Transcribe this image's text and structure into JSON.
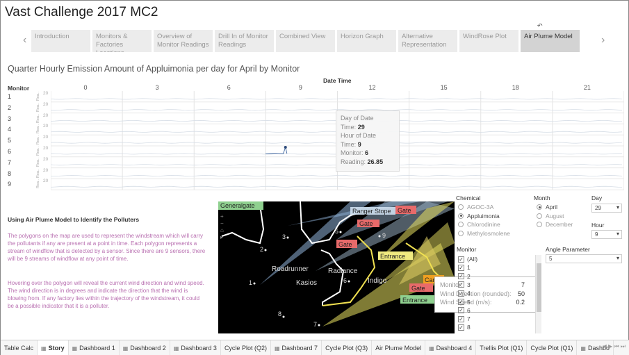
{
  "app_title": "Vast Challenge 2017 MC2",
  "icons": {
    "undo": "undo-icon",
    "prev": "chevron-left-icon",
    "next": "chevron-right-icon",
    "grid": "dashboard-grid-icon"
  },
  "story_tabs": [
    {
      "label": "Introduction"
    },
    {
      "label": "Monitors & Factories Locations"
    },
    {
      "label": "Overview of Monitor Readings"
    },
    {
      "label": "Drill In of Monitor Readings"
    },
    {
      "label": "Combined View"
    },
    {
      "label": "Horizon Graph"
    },
    {
      "label": "Alternative Representation"
    },
    {
      "label": "WindRose Plot"
    },
    {
      "label": "Air Plume Model"
    }
  ],
  "active_story_tab": 8,
  "chart": {
    "title": "Quarter Hourly Emission Amount of Appluimonia per day for April by Monitor",
    "x_header": "Date Time",
    "y_header": "Monitor",
    "mini_axis_label": "Rea..",
    "mini_axis_value": "20"
  },
  "chart_data": {
    "type": "line",
    "title": "Quarter Hourly Emission Amount of Appluimonia per day for April by Monitor",
    "xlabel": "Date Time",
    "ylabel": "Monitor",
    "x_ticks": [
      "0",
      "3",
      "6",
      "9",
      "12",
      "15",
      "18",
      "21"
    ],
    "xlim": [
      0,
      24
    ],
    "monitors": [
      "1",
      "2",
      "3",
      "4",
      "5",
      "6",
      "7",
      "8",
      "9"
    ],
    "highlight": {
      "monitor": "6",
      "day": 29,
      "hour": 9,
      "reading": 26.85
    }
  },
  "tooltip_reading": {
    "rows": [
      {
        "label": "Day of Date",
        "value": ""
      },
      {
        "label": "Time:",
        "value": "29"
      },
      {
        "label": "Hour of Date",
        "value": ""
      },
      {
        "label": "Time:",
        "value": "9"
      },
      {
        "label": "Monitor:",
        "value": "6"
      },
      {
        "label": "Reading:",
        "value": "26.85"
      }
    ]
  },
  "description": {
    "heading": "Using Air Plume Model to Identify the Polluters",
    "para1": "The polygons on the map are used to represent the windstream which will carry the pollutants if any are present at a point in time. Each polygon represents a stream of windflow that is detected by a sensor. Since there are 9 sensors, there will be 9 streams of windflow at any point of time.",
    "para2": "Hovering over the polygon will reveal the current wind direction and wind speed. The wind direction is in degrees and indicate the direction that the wind is blowing from. If any factory lies within the trajectory of the windstream, it could be a possible indicator that it is a polluter."
  },
  "map": {
    "factories": {
      "generalgate": "Generalgate",
      "ranger": "Ranger Stope",
      "gate_top": "Gate",
      "gate_a": "Gate",
      "gate_b": "Gate",
      "gate_c": "Gate",
      "entrance_a": "Entrance",
      "entrance_b": "Entrance",
      "car": "Car"
    },
    "places": {
      "roadrunner": "Roadrunner",
      "kasios": "Kasios",
      "radiance": "Radiance",
      "indigo": "Indigo"
    },
    "sensors": [
      "1",
      "2",
      "3",
      "4",
      "5",
      "6",
      "7",
      "8",
      "9"
    ],
    "zoom_icons": [
      "zoom-in-icon",
      "zoom-out-icon",
      "home-icon",
      "pan-icon"
    ]
  },
  "tooltip_wind": {
    "rows": [
      {
        "label": "Monitor:",
        "value": "7"
      },
      {
        "label": "Wind Direction (rounded):",
        "value": "50"
      },
      {
        "label": "Wind Speed (m/s):",
        "value": "0.2"
      }
    ]
  },
  "filters": {
    "chemical_label": "Chemical",
    "chemicals": [
      {
        "label": "AGOC-3A",
        "selected": false
      },
      {
        "label": "Appluimonia",
        "selected": true
      },
      {
        "label": "Chlorodinine",
        "selected": false
      },
      {
        "label": "Methylosmolene",
        "selected": false
      }
    ],
    "month_label": "Month",
    "months": [
      {
        "label": "April",
        "selected": true
      },
      {
        "label": "August",
        "selected": false
      },
      {
        "label": "December",
        "selected": false
      }
    ],
    "day_label": "Day",
    "day_value": "29",
    "hour_label": "Hour",
    "hour_value": "9",
    "angle_label": "Angle Parameter",
    "angle_value": "5",
    "monitor_label": "Monitor",
    "monitors": [
      "(All)",
      "1",
      "2",
      "3",
      "4",
      "5",
      "6",
      "7",
      "8"
    ]
  },
  "sheet_tabs": [
    {
      "label": "Table Calc",
      "icon": false
    },
    {
      "label": "Story",
      "icon": true,
      "active": true
    },
    {
      "label": "Dashboard 1",
      "icon": true
    },
    {
      "label": "Dashboard 2",
      "icon": true
    },
    {
      "label": "Dashboard 3",
      "icon": true
    },
    {
      "label": "Cycle Plot (Q2)",
      "icon": false
    },
    {
      "label": "Dashboard 7",
      "icon": true
    },
    {
      "label": "Cycle Plot (Q3)",
      "icon": false
    },
    {
      "label": "Air Plume Model",
      "icon": false
    },
    {
      "label": "Dashboard 4",
      "icon": true
    },
    {
      "label": "Trellis Plot (Q1)",
      "icon": false
    },
    {
      "label": "Cycle Plot (Q1)",
      "icon": false
    },
    {
      "label": "Dashbo",
      "icon": true
    }
  ],
  "colors": {
    "accent": "#4a6fa5",
    "plume_blue": "#8fb2d8",
    "plume_yellow": "#e8e060",
    "factory_red": "#e86a6a",
    "factory_green": "#7ec87e",
    "text_purple": "#b86fb0"
  }
}
